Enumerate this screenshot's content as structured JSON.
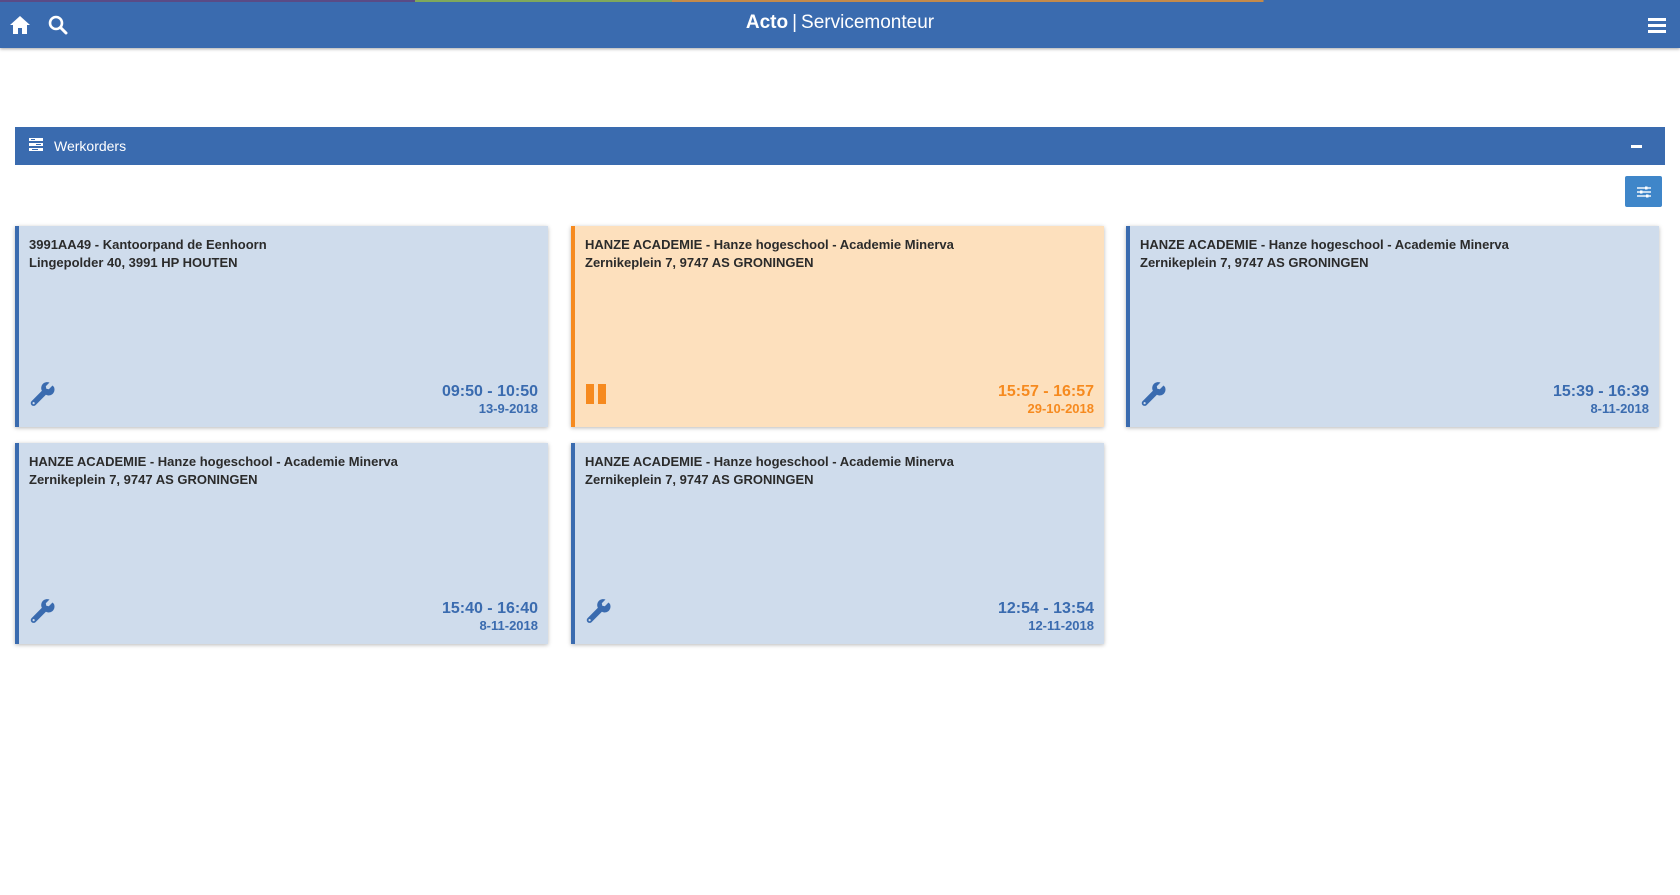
{
  "app": {
    "brand_name": "Acto",
    "brand_separator": "|",
    "brand_module": "Servicemonteur",
    "icons": {
      "home": "home-icon",
      "search": "search-icon",
      "menu": "hamburger-menu-icon"
    },
    "colors": {
      "primary": "#3a6baf",
      "card_default_bg": "#cfdcec",
      "card_paused_bg": "#fde0bd",
      "paused_accent": "#f68a1f"
    }
  },
  "panel": {
    "title": "Werkorders",
    "icon": "list-icon",
    "collapse_icon": "minus-icon",
    "filter_icon": "sliders-icon"
  },
  "workorders": [
    {
      "line1": "3991AA49 - Kantoorpand de Eenhoorn",
      "line2": "Lingepolder 40, 3991 HP HOUTEN",
      "time": "09:50 - 10:50",
      "date": "13-9-2018",
      "status": "open",
      "status_icon": "wrench-icon"
    },
    {
      "line1": "HANZE ACADEMIE - Hanze hogeschool - Academie Minerva",
      "line2": "Zernikeplein 7, 9747 AS GRONINGEN",
      "time": "15:57 - 16:57",
      "date": "29-10-2018",
      "status": "paused",
      "status_icon": "pause-icon"
    },
    {
      "line1": "HANZE ACADEMIE - Hanze hogeschool - Academie Minerva",
      "line2": "Zernikeplein 7, 9747 AS GRONINGEN",
      "time": "15:39 - 16:39",
      "date": "8-11-2018",
      "status": "open",
      "status_icon": "wrench-icon"
    },
    {
      "line1": "HANZE ACADEMIE - Hanze hogeschool - Academie Minerva",
      "line2": "Zernikeplein 7, 9747 AS GRONINGEN",
      "time": "15:40 - 16:40",
      "date": "8-11-2018",
      "status": "open",
      "status_icon": "wrench-icon"
    },
    {
      "line1": "HANZE ACADEMIE - Hanze hogeschool - Academie Minerva",
      "line2": "Zernikeplein 7, 9747 AS GRONINGEN",
      "time": "12:54 - 13:54",
      "date": "12-11-2018",
      "status": "open",
      "status_icon": "wrench-icon"
    }
  ]
}
